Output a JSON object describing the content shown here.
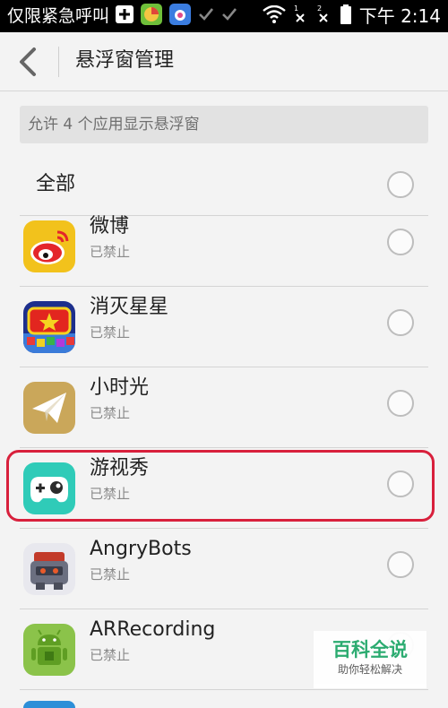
{
  "statusbar": {
    "carrier": "仅限紧急呼叫",
    "time": "下午 2:14",
    "sim1": "1",
    "sim2": "2",
    "icons": [
      "plus-box-icon",
      "app-icon",
      "camera-app-icon",
      "check-icon",
      "check-icon",
      "wifi-icon",
      "signal-sim1-icon",
      "signal-sim2-icon",
      "battery-icon"
    ]
  },
  "header": {
    "title": "悬浮窗管理",
    "back_icon": "back-arrow-icon"
  },
  "info": {
    "text": "允许 4 个应用显示悬浮窗"
  },
  "select_all": {
    "label": "全部"
  },
  "apps": [
    {
      "name": "微博",
      "status": "已禁止",
      "icon": "weibo-icon"
    },
    {
      "name": "消灭星星",
      "status": "已禁止",
      "icon": "popstar-icon"
    },
    {
      "name": "小时光",
      "status": "已禁止",
      "icon": "paper-plane-icon"
    },
    {
      "name": "游视秀",
      "status": "已禁止",
      "icon": "gamepad-icon"
    },
    {
      "name": "AngryBots",
      "status": "已禁止",
      "icon": "robot-icon"
    },
    {
      "name": "ARRecording",
      "status": "已禁止",
      "icon": "android-icon"
    }
  ],
  "watermark": {
    "main": "百科全说",
    "sub": "助你轻松解决"
  },
  "colors": {
    "highlight": "#d8203c",
    "watermark": "#21a86a"
  }
}
